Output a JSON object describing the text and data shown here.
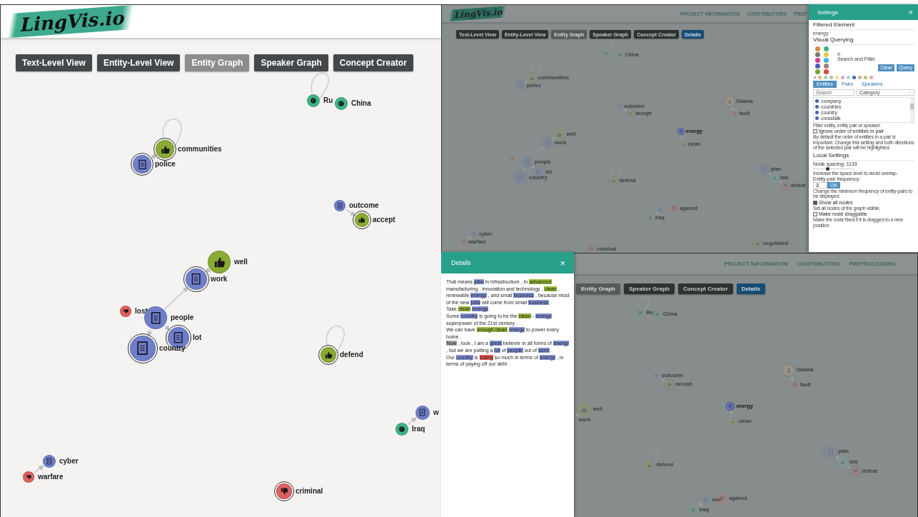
{
  "left_app": {
    "logo": "LingVis.io",
    "tabs": [
      {
        "label": "Text-Level View",
        "kind": "view",
        "selected": false
      },
      {
        "label": "Entity-Level View",
        "kind": "view",
        "selected": false
      },
      {
        "label": "Entity Graph",
        "kind": "view",
        "selected": true
      },
      {
        "label": "Speaker Graph",
        "kind": "view",
        "selected": false
      },
      {
        "label": "Concept Creator",
        "kind": "view",
        "selected": false
      }
    ],
    "graph": {
      "nodes": [
        {
          "label": "Ru",
          "kind": "globe"
        },
        {
          "label": "China",
          "kind": "globe"
        },
        {
          "label": "communities",
          "kind": "thumbs-up"
        },
        {
          "label": "police",
          "kind": "document"
        },
        {
          "label": "outcome",
          "kind": "document"
        },
        {
          "label": "accept",
          "kind": "thumbs-up"
        },
        {
          "label": "well",
          "kind": "thumbs-up"
        },
        {
          "label": "work",
          "kind": "document"
        },
        {
          "label": "lost",
          "kind": "thumbs-down"
        },
        {
          "label": "people",
          "kind": "document"
        },
        {
          "label": "lot",
          "kind": "document"
        },
        {
          "label": "country",
          "kind": "document"
        },
        {
          "label": "defend",
          "kind": "thumbs-up"
        },
        {
          "label": "w",
          "kind": "document"
        },
        {
          "label": "Iraq",
          "kind": "globe"
        },
        {
          "label": "cyber",
          "kind": "document"
        },
        {
          "label": "warfare",
          "kind": "thumbs-down"
        },
        {
          "label": "criminal",
          "kind": "thumbs-down"
        }
      ]
    }
  },
  "top_right_app": {
    "logo": "LingVis.io",
    "nav": [
      "PROJECT INFORMATION",
      "CONTRIBUTORS",
      "PREP"
    ],
    "tabs": [
      {
        "label": "Text-Level View",
        "kind": "view",
        "selected": false
      },
      {
        "label": "Entity-Level View",
        "kind": "view",
        "selected": false
      },
      {
        "label": "Entity Graph",
        "kind": "view",
        "selected": true
      },
      {
        "label": "Speaker Graph",
        "kind": "view",
        "selected": false
      },
      {
        "label": "Concept Creator",
        "kind": "view",
        "selected": false
      },
      {
        "label": "Details",
        "kind": "panel",
        "selected": true
      }
    ],
    "graph": {
      "nodes": [
        {
          "kind": "globe",
          "highlighted": false
        },
        {
          "label": "China",
          "kind": "globe",
          "highlighted": false
        },
        {
          "label": "communities",
          "kind": "thumbs-up",
          "highlighted": false
        },
        {
          "label": "police",
          "kind": "document",
          "highlighted": false
        },
        {
          "label": "outcome",
          "kind": "document",
          "highlighted": false
        },
        {
          "label": "accept",
          "kind": "thumbs-up",
          "highlighted": false
        },
        {
          "label": "Obama",
          "kind": "person",
          "highlighted": false
        },
        {
          "label": "fault",
          "kind": "thumbs-down",
          "highlighted": false
        },
        {
          "label": "energy",
          "kind": "document",
          "highlighted": true
        },
        {
          "label": "clean",
          "kind": "thumbs-up",
          "highlighted": false
        },
        {
          "label": "well",
          "kind": "thumbs-up",
          "highlighted": false
        },
        {
          "label": "work",
          "kind": "document",
          "highlighted": false
        },
        {
          "kind": "thumbs-down",
          "highlighted": false
        },
        {
          "label": "people",
          "kind": "document",
          "highlighted": false
        },
        {
          "label": "lot",
          "kind": "document",
          "highlighted": false
        },
        {
          "label": "country",
          "kind": "document",
          "highlighted": false
        },
        {
          "label": "defend",
          "kind": "thumbs-up",
          "highlighted": false
        },
        {
          "label": "plan",
          "kind": "document",
          "highlighted": false
        },
        {
          "label": "isis",
          "kind": "organization",
          "highlighted": false
        },
        {
          "label": "defeat",
          "kind": "thumbs-down",
          "highlighted": false
        },
        {
          "kind": "document",
          "highlighted": false
        },
        {
          "label": "against",
          "kind": "thumbs-down",
          "highlighted": false
        },
        {
          "label": "Iraq",
          "kind": "globe",
          "highlighted": false
        },
        {
          "label": "cyber",
          "kind": "document",
          "highlighted": false
        },
        {
          "label": "warfare",
          "kind": "thumbs-down",
          "highlighted": false
        },
        {
          "label": "criminal",
          "kind": "thumbs-down",
          "highlighted": false
        },
        {
          "label": "negotiated",
          "kind": "thumbs-up",
          "highlighted": false
        }
      ]
    }
  },
  "settings": {
    "title": "Settings",
    "close": "×",
    "filtered_title": "Filtered Element",
    "filtered_value": "energy",
    "querying_title": "Visual Querying",
    "query_icons": [
      {
        "color": "#e08a3c"
      },
      {
        "color": "#3cb486"
      },
      {
        "color": "#7a7a7a"
      },
      {
        "color": "#e8c84a"
      },
      {
        "color": "#d23f9a"
      },
      {
        "color": "#3ab7d6"
      },
      {
        "color": "#4a5fb3"
      },
      {
        "color": "#a08070"
      },
      {
        "color": "#7aa52a"
      },
      {
        "color": "#e04545"
      }
    ],
    "search_filter": "Search and Filter",
    "clear_button": "Clear",
    "query_button": "Query",
    "category_dots": [
      {
        "color": "#9a9a9a"
      },
      {
        "color": "#e8b08a"
      },
      {
        "color": "#9fd4a8"
      },
      {
        "color": "#bbbbbb"
      },
      {
        "color": "#f2e07a"
      },
      {
        "color": "#e8a0d0"
      },
      {
        "color": "#a0d8e6"
      },
      {
        "color": "#4a5fb3"
      },
      {
        "color": "#c8b0a0"
      },
      {
        "color": "#a8c878"
      },
      {
        "color": "#f0a0a0"
      }
    ],
    "tabs": [
      {
        "label": "Entities",
        "selected": true
      },
      {
        "label": "Pairs",
        "selected": false
      },
      {
        "label": "Speakers",
        "selected": false
      }
    ],
    "search": {
      "placeholder": "Search"
    },
    "category_select": "Category",
    "entities": [
      "company",
      "countries",
      "country",
      "crosstalk"
    ],
    "filter_hint": "Filter entity, entity pair or speaker.",
    "ignore_order": {
      "label": "Ignore order of entities in pair",
      "checked": false,
      "help": "By default the order of entities in a pair is important. Change this setting and both directions of the selected pair will be highlighted."
    },
    "local_title": "Local Settings",
    "spacing": {
      "label": "Node spacing: 1133",
      "level": 0.35,
      "help": "Increase the space level to avoid overlap."
    },
    "frequency": {
      "label": "Entity-pair frequency:",
      "value": "3",
      "button": "OK",
      "help": "Change the minimum frequency of entity-pairs to be displayed."
    },
    "show_all": {
      "label": "Show all nodes",
      "checked": true,
      "help": "Set all nodes of the graph visible."
    },
    "draggable": {
      "label": "Make node draggable",
      "checked": false,
      "help": "Make the node fixed if it is dragged to a new position."
    }
  },
  "details": {
    "title": "Details",
    "close": "×",
    "sentences": [
      {
        "segments": [
          {
            "text": "That means "
          },
          {
            "text": "jobs",
            "color": "#8391d8"
          },
          {
            "text": " in infrastructure , in "
          },
          {
            "text": "advanced",
            "color": "#9bbb3a"
          },
          {
            "text": " manufacturing , innovation and technology , "
          },
          {
            "text": "clean",
            "color": "#9bbb3a"
          },
          {
            "text": " , renewable "
          },
          {
            "text": "energy",
            "color": "#8391d8"
          },
          {
            "text": " , and small "
          },
          {
            "text": "business",
            "color": "#8391d8"
          },
          {
            "text": " , because most of the new "
          },
          {
            "text": "jobs",
            "color": "#8391d8"
          },
          {
            "text": " will come from small "
          },
          {
            "text": "business",
            "color": "#8391d8"
          },
          {
            "text": " ."
          }
        ]
      },
      {
        "segments": [
          {
            "text": "Take "
          },
          {
            "text": "clean",
            "color": "#9bbb3a"
          },
          {
            "text": " energy",
            "color": "#8391d8"
          },
          {
            "text": " ."
          }
        ]
      },
      {
        "segments": [
          {
            "text": "Some "
          },
          {
            "text": "country",
            "color": "#8391d8"
          },
          {
            "text": " is going to be the "
          },
          {
            "text": "clean",
            "color": "#9bbb3a"
          },
          {
            "text": " - "
          },
          {
            "text": "energy",
            "color": "#8391d8"
          },
          {
            "text": " superpower of the 21st century ."
          }
        ]
      },
      {
        "segments": [
          {
            "text": "We can have "
          },
          {
            "text": "enough clean",
            "color": "#9bbb3a"
          },
          {
            "text": " energy",
            "color": "#8391d8"
          },
          {
            "text": " to power every home ."
          }
        ]
      },
      {
        "segments": [
          {
            "text": "Now",
            "color": "#a9a9a9"
          },
          {
            "text": " , look , I am a "
          },
          {
            "text": "great",
            "color": "#8391d8"
          },
          {
            "text": " believer in all forms of "
          },
          {
            "text": "energy",
            "color": "#8391d8"
          },
          {
            "text": " , but we are putting a "
          },
          {
            "text": "lot",
            "color": "#8391d8"
          },
          {
            "text": " of "
          },
          {
            "text": "people",
            "color": "#8391d8"
          },
          {
            "text": " out of "
          },
          {
            "text": "work",
            "color": "#8391d8"
          },
          {
            "text": " ."
          }
        ]
      },
      {
        "segments": [
          {
            "text": "Our "
          },
          {
            "text": "country",
            "color": "#8391d8"
          },
          {
            "text": " is "
          },
          {
            "text": "losing",
            "color": "#e8524f"
          },
          {
            "text": " so much in terms of "
          },
          {
            "text": "energy",
            "color": "#8391d8"
          },
          {
            "text": " , in terms of paying off our debt ."
          }
        ]
      }
    ]
  },
  "bottom_right_app": {
    "nav": [
      "PROJECT INFORMATION",
      "CONTRIBUTORS",
      "PREPROCESSING"
    ],
    "tabs": [
      {
        "label": "Entity Graph",
        "kind": "view",
        "selected": true
      },
      {
        "label": "Speaker Graph",
        "kind": "view",
        "selected": false
      },
      {
        "label": "Concept Creator",
        "kind": "view",
        "selected": false
      },
      {
        "label": "Details",
        "kind": "panel",
        "selected": true
      }
    ],
    "graph": {
      "nodes": [
        {
          "label": "Ru",
          "kind": "globe",
          "highlighted": false
        },
        {
          "label": "China",
          "kind": "globe",
          "highlighted": false
        },
        {
          "label": "outcome",
          "kind": "document",
          "highlighted": false
        },
        {
          "label": "accept",
          "kind": "thumbs-up",
          "highlighted": false
        },
        {
          "label": "Obama",
          "kind": "person",
          "highlighted": false
        },
        {
          "label": "fault",
          "kind": "thumbs-down",
          "highlighted": false
        },
        {
          "label": "energy",
          "kind": "document",
          "highlighted": true
        },
        {
          "label": "clean",
          "kind": "thumbs-up",
          "highlighted": false
        },
        {
          "label": "well",
          "kind": "thumbs-up",
          "highlighted": false
        },
        {
          "label": "work",
          "highlighted": false
        },
        {
          "label": "defend",
          "kind": "thumbs-up",
          "highlighted": false
        },
        {
          "label": "plan",
          "kind": "document",
          "highlighted": false
        },
        {
          "label": "isis",
          "kind": "organization",
          "highlighted": false
        },
        {
          "label": "defeat",
          "kind": "thumbs-down",
          "highlighted": false
        },
        {
          "label": "war",
          "kind": "document",
          "highlighted": false
        },
        {
          "label": "against",
          "kind": "thumbs-down",
          "highlighted": false
        },
        {
          "label": "Iraq",
          "kind": "globe",
          "highlighted": false
        }
      ]
    }
  }
}
